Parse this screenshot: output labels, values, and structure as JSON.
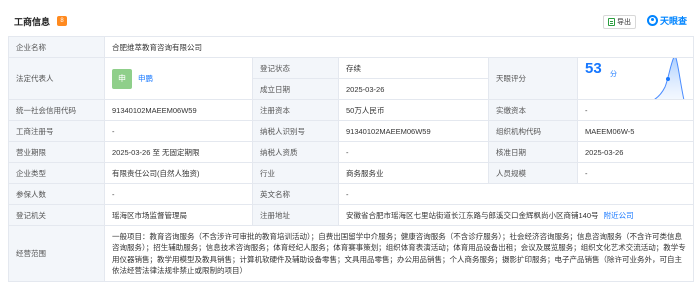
{
  "header": {
    "title": "工商信息",
    "badge": "8",
    "export_label": "导出",
    "brand": "天眼查"
  },
  "fields": {
    "company_name_label": "企业名称",
    "company_name": "合肥维萃教育咨询有限公司",
    "legal_rep_label": "法定代表人",
    "legal_rep_avatar": "申",
    "legal_rep_name": "申鹏",
    "reg_status_label": "登记状态",
    "reg_status": "存续",
    "rating_label": "天眼评分",
    "rating_value": "53",
    "rating_unit": "分",
    "est_date_label": "成立日期",
    "est_date": "2025-03-26",
    "credit_code_label": "统一社会信用代码",
    "credit_code": "91340102MAEEM06W59",
    "reg_capital_label": "注册资本",
    "reg_capital": "50万人民币",
    "paid_capital_label": "实缴资本",
    "paid_capital": "-",
    "reg_no_label": "工商注册号",
    "reg_no": "-",
    "taxpayer_id_label": "纳税人识别号",
    "taxpayer_id": "91340102MAEEM06W59",
    "org_code_label": "组织机构代码",
    "org_code": "MAEEM06W-5",
    "term_label": "营业期限",
    "term": "2025-03-26 至 无固定期限",
    "taxpayer_qual_label": "纳税人资质",
    "taxpayer_qual": "-",
    "approval_date_label": "核准日期",
    "approval_date": "2025-03-26",
    "company_type_label": "企业类型",
    "company_type": "有限责任公司(自然人独资)",
    "industry_label": "行业",
    "industry": "商务服务业",
    "staff_size_label": "人员规模",
    "staff_size": "-",
    "insured_label": "参保人数",
    "insured": "-",
    "english_name_label": "英文名称",
    "english_name": "-",
    "reg_authority_label": "登记机关",
    "reg_authority": "瑶海区市场监督管理局",
    "reg_address_label": "注册地址",
    "reg_address": "安徽省合肥市瑶海区七里站街道长江东路与郎溪交口金辉枫尚小区商铺140号",
    "nearby_link": "附近公司",
    "scope_label": "经营范围",
    "scope": "一般项目：教育咨询服务（不含涉许可审批的教育培训活动）；自费出国留学中介服务；健康咨询服务（不含诊疗服务）；社会经济咨询服务；信息咨询服务（不含许可类信息咨询服务）；招生辅助服务；信息技术咨询服务；体育经纪人服务；体育赛事策划；组织体育表演活动；体育用品设备出租；会议及展览服务；组织文化艺术交流活动；教学专用仪器销售；教学用模型及教具销售；计算机软硬件及辅助设备零售；文具用品零售；办公用品销售；个人商务服务；摄影扩印服务；电子产品销售（除许可业务外，可自主依法经营法律法规非禁止或限制的项目）"
  },
  "colors": {
    "accent": "#1677ff",
    "status_green": "#2a9d3e",
    "label_bg": "#f3f6fa",
    "badge_orange": "#ff8a1f"
  }
}
